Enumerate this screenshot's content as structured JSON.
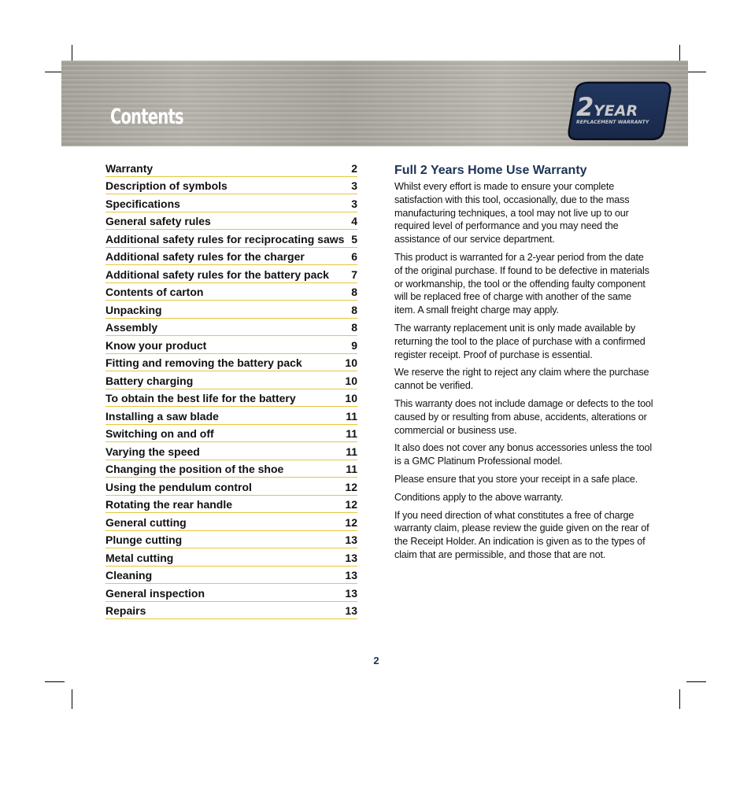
{
  "header": {
    "title": "Contents",
    "badge": {
      "number": "2",
      "word": "YEAR",
      "subtitle": "REPLACEMENT WARRANTY",
      "color": "#1b2d52"
    }
  },
  "toc": {
    "rule_color": "#e8c53a",
    "items": [
      {
        "label": "Warranty",
        "page": "2"
      },
      {
        "label": "Description of symbols",
        "page": "3"
      },
      {
        "label": "Specifications",
        "page": "3"
      },
      {
        "label": "General safety rules",
        "page": "4"
      },
      {
        "label": "Additional safety rules for reciprocating saws",
        "page": "5"
      },
      {
        "label": "Additional safety rules for the charger",
        "page": "6"
      },
      {
        "label": "Additional safety rules for the battery pack",
        "page": "7"
      },
      {
        "label": "Contents of carton",
        "page": "8"
      },
      {
        "label": "Unpacking",
        "page": "8"
      },
      {
        "label": "Assembly",
        "page": "8"
      },
      {
        "label": "Know your product",
        "page": "9"
      },
      {
        "label": "Fitting and removing the battery pack",
        "page": "10"
      },
      {
        "label": "Battery charging",
        "page": "10"
      },
      {
        "label": "To obtain the best life for the battery",
        "page": "10"
      },
      {
        "label": "Installing a saw blade",
        "page": "11"
      },
      {
        "label": "Switching on and off",
        "page": "11"
      },
      {
        "label": "Varying the speed",
        "page": "11"
      },
      {
        "label": "Changing the position of the shoe",
        "page": "11"
      },
      {
        "label": "Using the pendulum control",
        "page": "12"
      },
      {
        "label": "Rotating the rear handle",
        "page": "12"
      },
      {
        "label": "General cutting",
        "page": "12"
      },
      {
        "label": "Plunge cutting",
        "page": "13"
      },
      {
        "label": "Metal cutting",
        "page": "13"
      },
      {
        "label": "Cleaning",
        "page": "13"
      },
      {
        "label": "General inspection",
        "page": "13"
      },
      {
        "label": "Repairs",
        "page": "13"
      }
    ]
  },
  "warranty": {
    "heading": "Full 2 Years Home Use Warranty",
    "heading_color": "#1e3355",
    "paragraphs": [
      "Whilst every effort is made to ensure your complete satisfaction with this tool, occasionally, due to the mass manufacturing techniques, a tool may not live up to our required level of performance and you may need the assistance of our service department.",
      "This product is warranted for a 2-year period from the date of the original purchase. If found to be defective in materials or workmanship, the tool or the offending faulty component will be replaced free of charge with another of the same item. A small freight charge may apply.",
      "The warranty replacement unit is only made available by returning the tool to the place of purchase with a confirmed register receipt. Proof of purchase is essential.",
      "We reserve the right to reject any claim where the purchase cannot be verified.",
      "This warranty does not include damage or defects to the tool caused by or resulting from abuse, accidents, alterations or commercial or business use.",
      "It also does not cover any bonus accessories unless the tool is a GMC Platinum Professional model.",
      "Please ensure that you store your receipt in a safe place.",
      "Conditions apply to the above warranty.",
      "If you need direction of what constitutes a free of charge warranty claim, please review the guide given on the rear of the Receipt Holder. An indication is given as to the types of claim that are permissible, and those that are not."
    ]
  },
  "footer": {
    "page_number": "2"
  }
}
